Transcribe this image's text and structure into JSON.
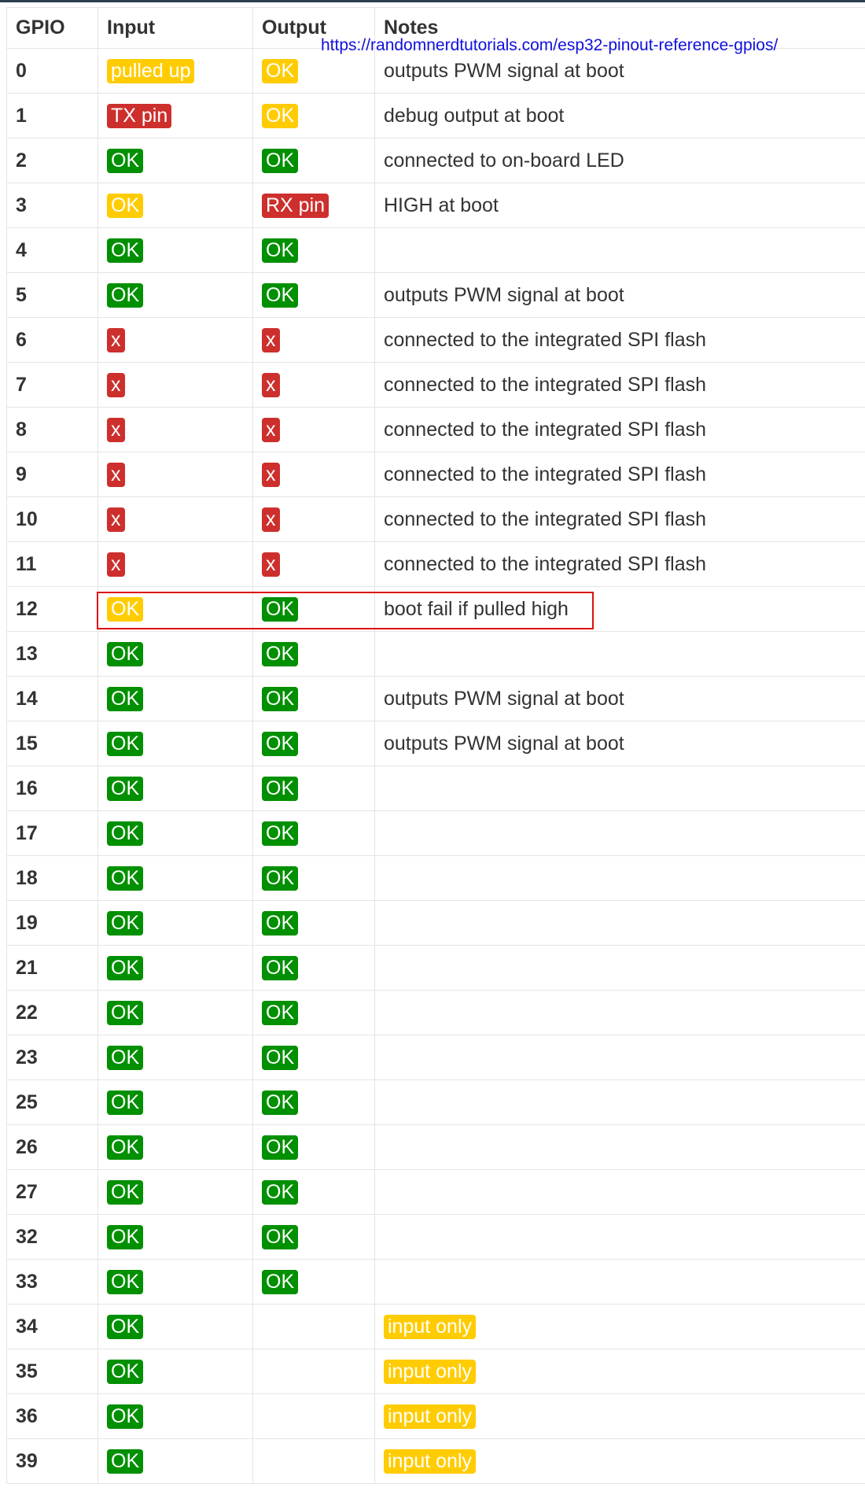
{
  "source_url": "https://randomnerdtutorials.com/esp32-pinout-reference-gpios/",
  "header": {
    "gpio": "GPIO",
    "input": "Input",
    "output": "Output",
    "notes": "Notes"
  },
  "colors": {
    "ok": "#019001",
    "warn": "#ffcc02",
    "bad": "#cd2f2d",
    "highlight_box": "#dd1010",
    "link": "#1010dd"
  },
  "highlighted_gpio": "12",
  "rows": [
    {
      "gpio": "0",
      "input": {
        "text": "pulled up",
        "status": "warn"
      },
      "output": {
        "text": "OK",
        "status": "warn"
      },
      "notes": {
        "text": "outputs PWM signal at boot",
        "status": ""
      }
    },
    {
      "gpio": "1",
      "input": {
        "text": "TX pin",
        "status": "bad"
      },
      "output": {
        "text": "OK",
        "status": "warn"
      },
      "notes": {
        "text": "debug output at boot",
        "status": ""
      }
    },
    {
      "gpio": "2",
      "input": {
        "text": "OK",
        "status": "ok"
      },
      "output": {
        "text": "OK",
        "status": "ok"
      },
      "notes": {
        "text": "connected to on-board LED",
        "status": ""
      }
    },
    {
      "gpio": "3",
      "input": {
        "text": "OK",
        "status": "warn"
      },
      "output": {
        "text": "RX pin",
        "status": "bad"
      },
      "notes": {
        "text": "HIGH at boot",
        "status": ""
      }
    },
    {
      "gpio": "4",
      "input": {
        "text": "OK",
        "status": "ok"
      },
      "output": {
        "text": "OK",
        "status": "ok"
      },
      "notes": {
        "text": "",
        "status": ""
      }
    },
    {
      "gpio": "5",
      "input": {
        "text": "OK",
        "status": "ok"
      },
      "output": {
        "text": "OK",
        "status": "ok"
      },
      "notes": {
        "text": "outputs PWM signal at boot",
        "status": ""
      }
    },
    {
      "gpio": "6",
      "input": {
        "text": "x",
        "status": "bad"
      },
      "output": {
        "text": "x",
        "status": "bad"
      },
      "notes": {
        "text": "connected to the integrated SPI flash",
        "status": ""
      }
    },
    {
      "gpio": "7",
      "input": {
        "text": "x",
        "status": "bad"
      },
      "output": {
        "text": "x",
        "status": "bad"
      },
      "notes": {
        "text": "connected to the integrated SPI flash",
        "status": ""
      }
    },
    {
      "gpio": "8",
      "input": {
        "text": "x",
        "status": "bad"
      },
      "output": {
        "text": "x",
        "status": "bad"
      },
      "notes": {
        "text": "connected to the integrated SPI flash",
        "status": ""
      }
    },
    {
      "gpio": "9",
      "input": {
        "text": "x",
        "status": "bad"
      },
      "output": {
        "text": "x",
        "status": "bad"
      },
      "notes": {
        "text": "connected to the integrated SPI flash",
        "status": ""
      }
    },
    {
      "gpio": "10",
      "input": {
        "text": "x",
        "status": "bad"
      },
      "output": {
        "text": "x",
        "status": "bad"
      },
      "notes": {
        "text": "connected to the integrated SPI flash",
        "status": ""
      }
    },
    {
      "gpio": "11",
      "input": {
        "text": "x",
        "status": "bad"
      },
      "output": {
        "text": "x",
        "status": "bad"
      },
      "notes": {
        "text": "connected to the integrated SPI flash",
        "status": ""
      }
    },
    {
      "gpio": "12",
      "input": {
        "text": "OK",
        "status": "warn"
      },
      "output": {
        "text": "OK",
        "status": "ok"
      },
      "notes": {
        "text": "boot fail if pulled high",
        "status": ""
      }
    },
    {
      "gpio": "13",
      "input": {
        "text": "OK",
        "status": "ok"
      },
      "output": {
        "text": "OK",
        "status": "ok"
      },
      "notes": {
        "text": "",
        "status": ""
      }
    },
    {
      "gpio": "14",
      "input": {
        "text": "OK",
        "status": "ok"
      },
      "output": {
        "text": "OK",
        "status": "ok"
      },
      "notes": {
        "text": "outputs PWM signal at boot",
        "status": ""
      }
    },
    {
      "gpio": "15",
      "input": {
        "text": "OK",
        "status": "ok"
      },
      "output": {
        "text": "OK",
        "status": "ok"
      },
      "notes": {
        "text": "outputs PWM signal at boot",
        "status": ""
      }
    },
    {
      "gpio": "16",
      "input": {
        "text": "OK",
        "status": "ok"
      },
      "output": {
        "text": "OK",
        "status": "ok"
      },
      "notes": {
        "text": "",
        "status": ""
      }
    },
    {
      "gpio": "17",
      "input": {
        "text": "OK",
        "status": "ok"
      },
      "output": {
        "text": "OK",
        "status": "ok"
      },
      "notes": {
        "text": "",
        "status": ""
      }
    },
    {
      "gpio": "18",
      "input": {
        "text": "OK",
        "status": "ok"
      },
      "output": {
        "text": "OK",
        "status": "ok"
      },
      "notes": {
        "text": "",
        "status": ""
      }
    },
    {
      "gpio": "19",
      "input": {
        "text": "OK",
        "status": "ok"
      },
      "output": {
        "text": "OK",
        "status": "ok"
      },
      "notes": {
        "text": "",
        "status": ""
      }
    },
    {
      "gpio": "21",
      "input": {
        "text": "OK",
        "status": "ok"
      },
      "output": {
        "text": "OK",
        "status": "ok"
      },
      "notes": {
        "text": "",
        "status": ""
      }
    },
    {
      "gpio": "22",
      "input": {
        "text": "OK",
        "status": "ok"
      },
      "output": {
        "text": "OK",
        "status": "ok"
      },
      "notes": {
        "text": "",
        "status": ""
      }
    },
    {
      "gpio": "23",
      "input": {
        "text": "OK",
        "status": "ok"
      },
      "output": {
        "text": "OK",
        "status": "ok"
      },
      "notes": {
        "text": "",
        "status": ""
      }
    },
    {
      "gpio": "25",
      "input": {
        "text": "OK",
        "status": "ok"
      },
      "output": {
        "text": "OK",
        "status": "ok"
      },
      "notes": {
        "text": "",
        "status": ""
      }
    },
    {
      "gpio": "26",
      "input": {
        "text": "OK",
        "status": "ok"
      },
      "output": {
        "text": "OK",
        "status": "ok"
      },
      "notes": {
        "text": "",
        "status": ""
      }
    },
    {
      "gpio": "27",
      "input": {
        "text": "OK",
        "status": "ok"
      },
      "output": {
        "text": "OK",
        "status": "ok"
      },
      "notes": {
        "text": "",
        "status": ""
      }
    },
    {
      "gpio": "32",
      "input": {
        "text": "OK",
        "status": "ok"
      },
      "output": {
        "text": "OK",
        "status": "ok"
      },
      "notes": {
        "text": "",
        "status": ""
      }
    },
    {
      "gpio": "33",
      "input": {
        "text": "OK",
        "status": "ok"
      },
      "output": {
        "text": "OK",
        "status": "ok"
      },
      "notes": {
        "text": "",
        "status": ""
      }
    },
    {
      "gpio": "34",
      "input": {
        "text": "OK",
        "status": "ok"
      },
      "output": {
        "text": "",
        "status": ""
      },
      "notes": {
        "text": "input only",
        "status": "warn"
      }
    },
    {
      "gpio": "35",
      "input": {
        "text": "OK",
        "status": "ok"
      },
      "output": {
        "text": "",
        "status": ""
      },
      "notes": {
        "text": "input only",
        "status": "warn"
      }
    },
    {
      "gpio": "36",
      "input": {
        "text": "OK",
        "status": "ok"
      },
      "output": {
        "text": "",
        "status": ""
      },
      "notes": {
        "text": "input only",
        "status": "warn"
      }
    },
    {
      "gpio": "39",
      "input": {
        "text": "OK",
        "status": "ok"
      },
      "output": {
        "text": "",
        "status": ""
      },
      "notes": {
        "text": "input only",
        "status": "warn"
      }
    }
  ]
}
